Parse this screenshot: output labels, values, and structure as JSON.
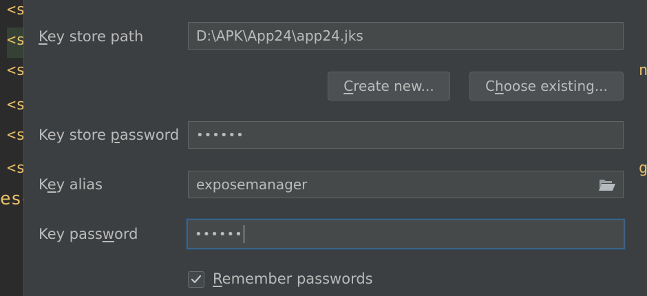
{
  "editor": {
    "lines": [
      "<s",
      "<s",
      "<s",
      "<s",
      "<s",
      "<s",
      "esc"
    ],
    "right_glyphs": [
      "n",
      "g"
    ]
  },
  "form": {
    "key_store_path": {
      "label_pre": "",
      "label_mnemonic": "K",
      "label_post": "ey store path",
      "value": "D:\\APK\\App24\\app24.jks"
    },
    "create_new": {
      "label_pre": "",
      "label_mnemonic": "C",
      "label_post": "reate new..."
    },
    "choose_existing": {
      "label_pre": "C",
      "label_mnemonic": "h",
      "label_post": "oose existing..."
    },
    "key_store_password": {
      "label_pre": "Key store ",
      "label_mnemonic": "p",
      "label_post": "assword",
      "value": "••••••"
    },
    "key_alias": {
      "label_pre": "K",
      "label_mnemonic": "e",
      "label_post": "y alias",
      "value": "exposemanager"
    },
    "key_password": {
      "label_pre": "Key pass",
      "label_mnemonic": "w",
      "label_post": "ord",
      "value": "••••••"
    },
    "remember": {
      "label_pre": "",
      "label_mnemonic": "R",
      "label_post": "emember passwords",
      "checked": true
    }
  },
  "colors": {
    "dialog_bg": "#3c3f41",
    "field_bg": "#45494a",
    "focus_border": "#3d6185",
    "text": "#bbbbbb",
    "xml_tag": "#e8bf6a"
  }
}
